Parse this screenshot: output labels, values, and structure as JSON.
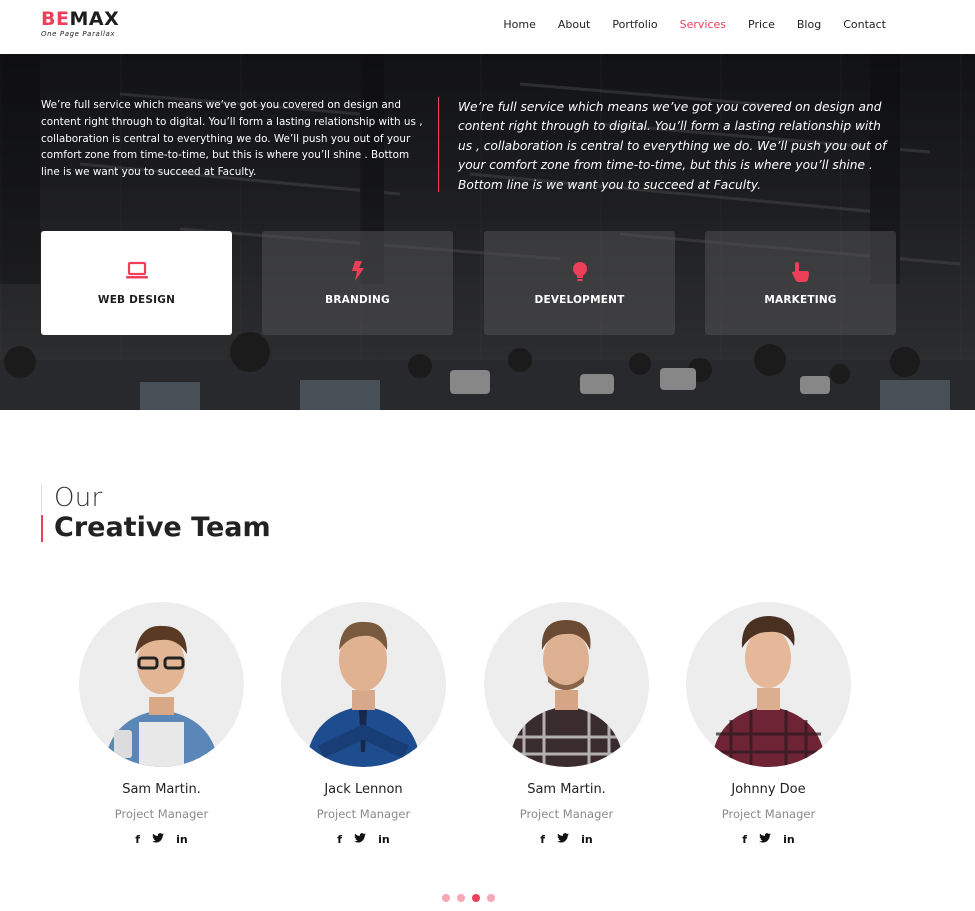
{
  "header": {
    "logo_prefix": "BE",
    "logo_suffix": "MAX",
    "tagline": "One Page Parallax",
    "nav": [
      "Home",
      "About",
      "Portfolio",
      "Services",
      "Price",
      "Blog",
      "Contact"
    ],
    "active_nav": "Services"
  },
  "hero": {
    "left_text": "We’re full service which means we’ve got you covered on design and content right through to digital. You’ll form a lasting relationship with us , collaboration is central to everything we do. We’ll push you out of your comfort zone from time-to-time, but this is where you’ll shine . Bottom line is we want you to succeed at Faculty.",
    "right_text": "We’re full service which means we’ve got you covered on design and content right through to digital. You’ll form a lasting relationship with us , collaboration is central to everything we do. We’ll push you out of your comfort zone from time-to-time, but this is where you’ll shine . Bottom line is we want you to succeed at Faculty.",
    "services": [
      {
        "label": "WEB DESIGN",
        "icon": "laptop-icon",
        "active": true
      },
      {
        "label": "BRANDING",
        "icon": "bolt-icon",
        "active": false
      },
      {
        "label": "DEVELOPMENT",
        "icon": "bulb-icon",
        "active": false
      },
      {
        "label": "MARKETING",
        "icon": "pointer-hand-icon",
        "active": false
      }
    ]
  },
  "team": {
    "subtitle": "Our",
    "title": "Creative Team",
    "members": [
      {
        "name": "Sam Martin.",
        "role": "Project Manager",
        "shirt": "#5b86b8"
      },
      {
        "name": "Jack Lennon",
        "role": "Project Manager",
        "shirt": "#1e4d8f"
      },
      {
        "name": "Sam Martin.",
        "role": "Project Manager",
        "shirt": "#4a3a3a"
      },
      {
        "name": "Johnny Doe",
        "role": "Project Manager",
        "shirt": "#7a2a3a"
      }
    ],
    "social": [
      "f",
      "twitter-icon",
      "in"
    ],
    "carousel_active_index": 2
  },
  "colors": {
    "accent": "#ee3f5a",
    "dot_inactive": "#f5a7b4"
  }
}
